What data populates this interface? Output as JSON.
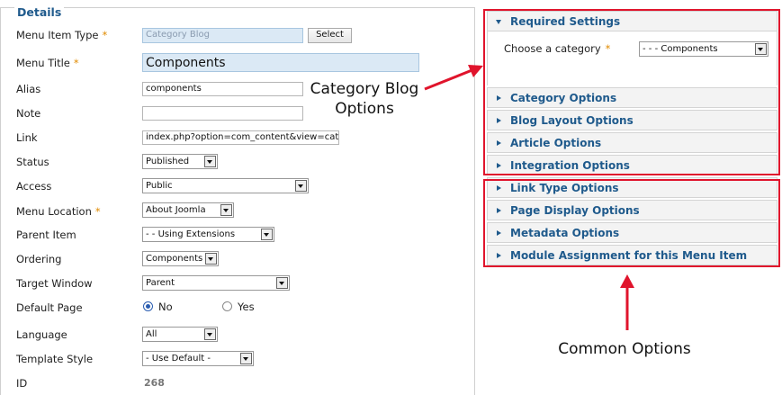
{
  "details": {
    "legend": "Details",
    "fields": {
      "menu_item_type": {
        "label": "Menu Item Type",
        "value": "Category Blog",
        "button": "Select"
      },
      "menu_title": {
        "label": "Menu Title",
        "value": "Components"
      },
      "alias": {
        "label": "Alias",
        "value": "components"
      },
      "note": {
        "label": "Note",
        "value": ""
      },
      "link": {
        "label": "Link",
        "value": "index.php?option=com_content&view=category"
      },
      "status": {
        "label": "Status",
        "value": "Published"
      },
      "access": {
        "label": "Access",
        "value": "Public"
      },
      "menu_location": {
        "label": "Menu Location",
        "value": "About Joomla"
      },
      "parent_item": {
        "label": "Parent Item",
        "value": "- - Using Extensions"
      },
      "ordering": {
        "label": "Ordering",
        "value": "Components"
      },
      "target_window": {
        "label": "Target Window",
        "value": "Parent"
      },
      "default_page": {
        "label": "Default Page",
        "no": "No",
        "yes": "Yes",
        "selected": "No"
      },
      "language": {
        "label": "Language",
        "value": "All"
      },
      "template_style": {
        "label": "Template Style",
        "value": "- Use Default -"
      },
      "id": {
        "label": "ID",
        "value": "268"
      }
    },
    "required_marker": "*"
  },
  "required_settings": {
    "title": "Required Settings",
    "choose_category_label": "Choose a category",
    "choose_category_value": "- - - Components"
  },
  "panels": {
    "category_options": "Category Options",
    "blog_layout_options": "Blog Layout Options",
    "article_options": "Article Options",
    "integration_options": "Integration Options",
    "link_type_options": "Link Type Options",
    "page_display_options": "Page Display Options",
    "metadata_options": "Metadata Options",
    "module_assignment": "Module Assignment for this Menu Item"
  },
  "annotations": {
    "category_blog_line1": "Category Blog",
    "category_blog_line2": "Options",
    "common_options": "Common Options",
    "accent_color": "#e0142c"
  }
}
